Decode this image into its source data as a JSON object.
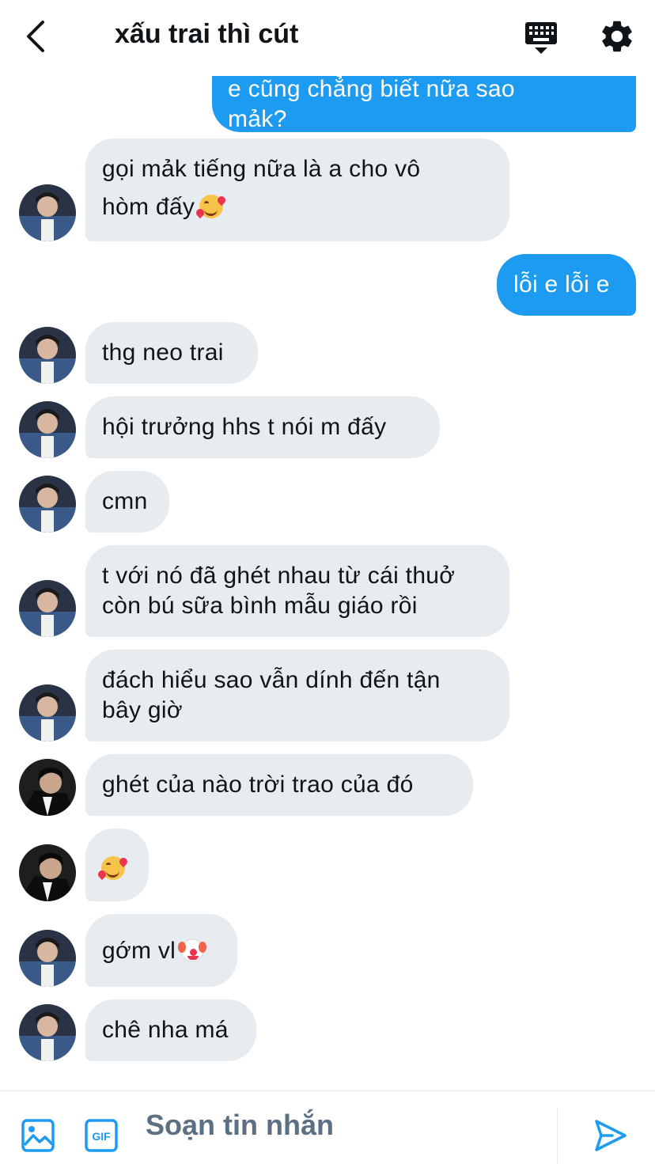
{
  "header": {
    "title": "xấu trai thì cút",
    "icons": {
      "back": "chevron-left-icon",
      "keyboard": "keyboard-icon",
      "settings": "gear-icon"
    }
  },
  "messages": [
    {
      "from": "me",
      "lines": [
        "e cũng chẳng biết nữa sao",
        "mảk?"
      ]
    },
    {
      "from": "them",
      "lines": [
        "gọi mảk tiếng nữa là a cho vô",
        "hòm đấy"
      ],
      "emoji": "smiling-face-with-hearts"
    },
    {
      "from": "me",
      "lines": [
        "lỗi e lỗi e"
      ]
    },
    {
      "from": "them",
      "lines": [
        "thg neo trai"
      ]
    },
    {
      "from": "them",
      "lines": [
        "hội trưởng hhs t nói m đấy"
      ]
    },
    {
      "from": "them",
      "lines": [
        "cmn"
      ]
    },
    {
      "from": "them",
      "lines": [
        "t với nó đã ghét nhau từ cái thuở",
        "còn bú sữa bình mẫu giáo rồi"
      ]
    },
    {
      "from": "them",
      "lines": [
        "đách hiểu sao vẫn dính đến tận",
        "bây giờ"
      ]
    },
    {
      "from": "other",
      "lines": [
        "ghét của nào trời trao của đó"
      ]
    },
    {
      "from": "other",
      "lines": [
        ""
      ],
      "emoji": "smiling-face-with-hearts"
    },
    {
      "from": "them",
      "lines": [
        "gớm vl"
      ],
      "emoji": "clown-face"
    },
    {
      "from": "them",
      "lines": [
        "chê nha má"
      ]
    }
  ],
  "composer": {
    "placeholder": "Soạn tin nhắn",
    "gif_label": "GIF",
    "icons": {
      "image": "image-icon",
      "gif": "gif-icon",
      "send": "send-icon"
    }
  },
  "colors": {
    "sent_bubble": "#1d9bf0",
    "received_bubble": "#e7ecf0",
    "accent": "#1d9bf0",
    "text": "#0f1419"
  }
}
